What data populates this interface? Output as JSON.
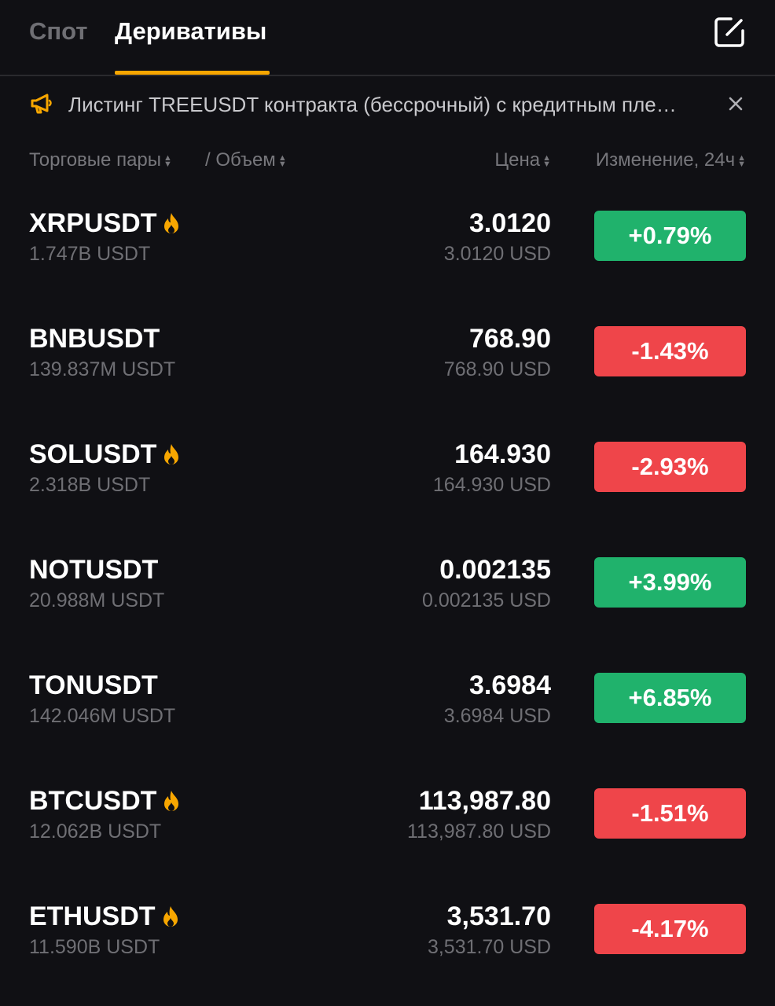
{
  "tabs": [
    {
      "label": "Спот"
    },
    {
      "label": "Деривативы"
    }
  ],
  "announcement": {
    "text": "Листинг TREEUSDT контракта (бессрочный) с кредитным пле…"
  },
  "columns": {
    "pairs": "Торговые пары",
    "separator": "/",
    "volume": "Объем",
    "price": "Цена",
    "change": "Изменение, 24ч"
  },
  "colors": {
    "accent": "#f7a600",
    "up": "#20b26c",
    "down": "#ef454a",
    "background": "#101014"
  },
  "rows": [
    {
      "symbol": "XRPUSDT",
      "hot": true,
      "volume": "1.747B USDT",
      "price": "3.0120",
      "price_usd": "3.0120 USD",
      "change": "+0.79%",
      "direction": "up"
    },
    {
      "symbol": "BNBUSDT",
      "hot": false,
      "volume": "139.837M USDT",
      "price": "768.90",
      "price_usd": "768.90 USD",
      "change": "-1.43%",
      "direction": "down"
    },
    {
      "symbol": "SOLUSDT",
      "hot": true,
      "volume": "2.318B USDT",
      "price": "164.930",
      "price_usd": "164.930 USD",
      "change": "-2.93%",
      "direction": "down"
    },
    {
      "symbol": "NOTUSDT",
      "hot": false,
      "volume": "20.988M USDT",
      "price": "0.002135",
      "price_usd": "0.002135 USD",
      "change": "+3.99%",
      "direction": "up"
    },
    {
      "symbol": "TONUSDT",
      "hot": false,
      "volume": "142.046M USDT",
      "price": "3.6984",
      "price_usd": "3.6984 USD",
      "change": "+6.85%",
      "direction": "up"
    },
    {
      "symbol": "BTCUSDT",
      "hot": true,
      "volume": "12.062B USDT",
      "price": "113,987.80",
      "price_usd": "113,987.80 USD",
      "change": "-1.51%",
      "direction": "down"
    },
    {
      "symbol": "ETHUSDT",
      "hot": true,
      "volume": "11.590B USDT",
      "price": "3,531.70",
      "price_usd": "3,531.70 USD",
      "change": "-4.17%",
      "direction": "down"
    }
  ]
}
